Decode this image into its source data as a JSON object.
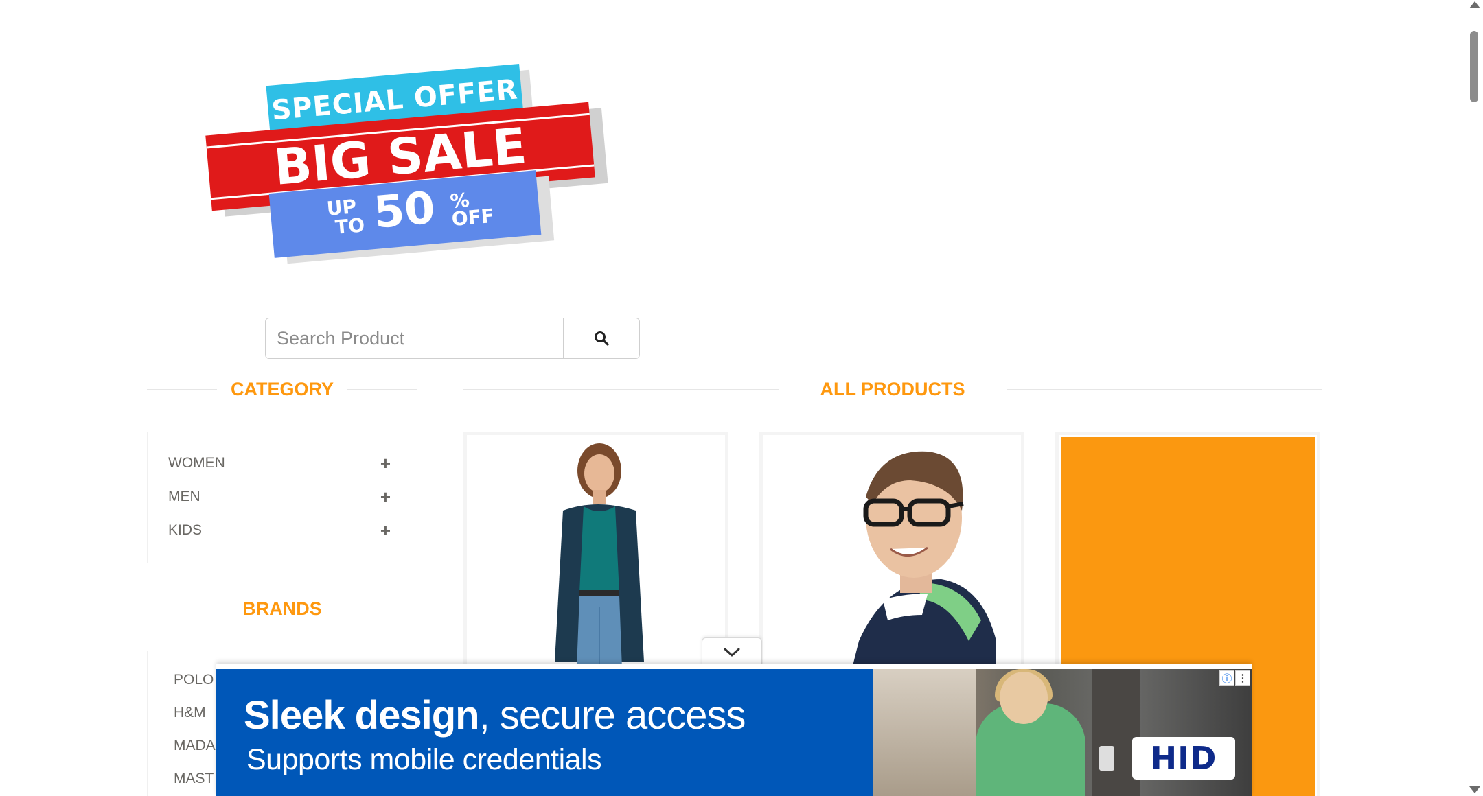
{
  "banner": {
    "line1": "SPECIAL OFFER",
    "line2": "BIG SALE",
    "upto_up": "UP",
    "upto_to": "TO",
    "percent": "50",
    "percent_sign": "%",
    "off": "OFF"
  },
  "search": {
    "placeholder": "Search Product",
    "icon": "search-icon"
  },
  "sidebar": {
    "category_title": "CATEGORY",
    "categories": [
      {
        "label": "WOMEN",
        "icon": "plus-icon"
      },
      {
        "label": "MEN",
        "icon": "plus-icon"
      },
      {
        "label": "KIDS",
        "icon": "plus-icon"
      }
    ],
    "brands_title": "BRANDS",
    "brands": [
      "POLO",
      "H&M",
      "MADAME",
      "MAST & HARBOUR"
    ]
  },
  "main": {
    "title": "ALL PRODUCTS",
    "products": [
      {
        "image": "woman-in-navy-cardigan"
      },
      {
        "image": "man-with-glasses-striped-sweater"
      },
      {
        "image": "orange-product-image"
      }
    ]
  },
  "ad": {
    "headline_bold": "Sleek design",
    "headline_rest": ", secure access",
    "subline": "Supports mobile credentials",
    "brand": "HID",
    "info_icon": "info-icon",
    "menu_icon": "more-vertical-icon",
    "collapse_icon": "chevron-down-icon"
  },
  "colors": {
    "accent": "#fe980f",
    "banner_red": "#e01a1a",
    "banner_cyan": "#2fbfe6",
    "banner_blue": "#5e89ea",
    "ad_blue": "#0057b8",
    "text_gray": "#696763"
  }
}
